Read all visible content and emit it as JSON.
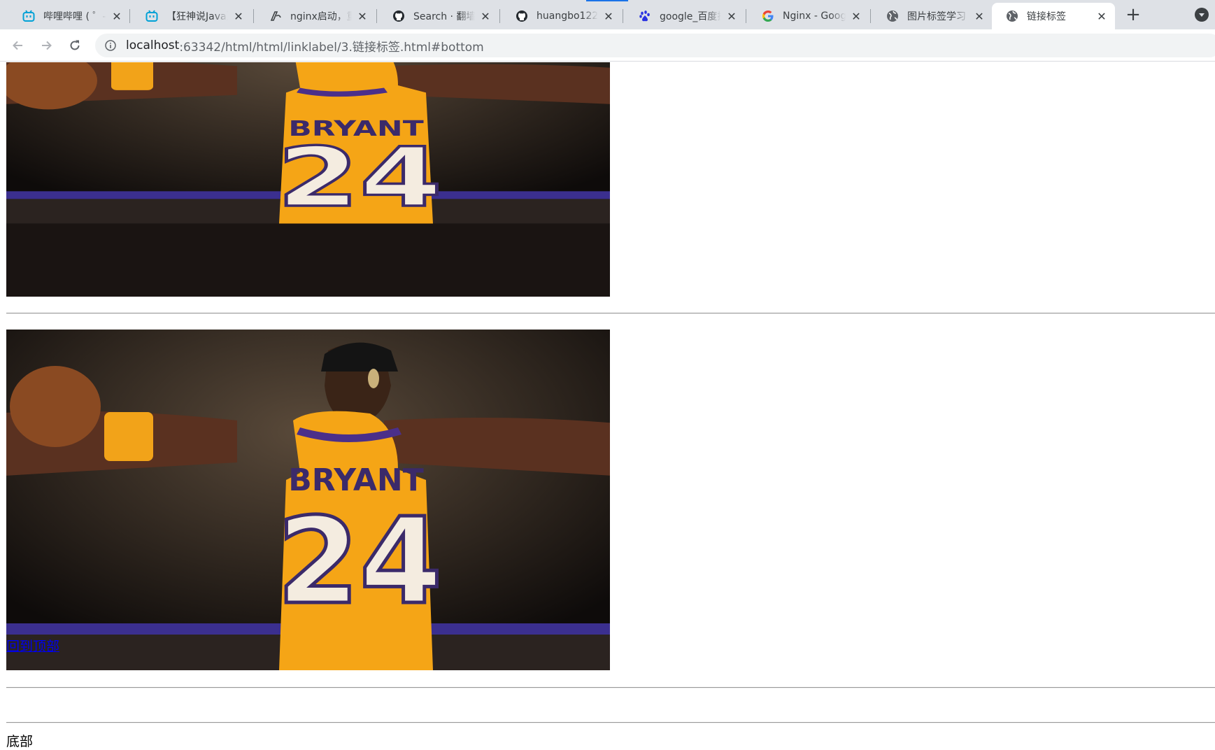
{
  "browser": {
    "tabs": [
      {
        "title": "哔哩哔哩 ( ゜- ゜)つロ 干杯~",
        "favicon": "bilibili-icon",
        "active": false
      },
      {
        "title": "【狂神说Java】",
        "favicon": "bilibili-icon",
        "active": false
      },
      {
        "title": "nginx启动，重启",
        "favicon": "csdn-icon",
        "active": false
      },
      {
        "title": "Search · 翻墙",
        "favicon": "github-icon",
        "active": false
      },
      {
        "title": "huangbo122",
        "favicon": "github-icon",
        "active": false
      },
      {
        "title": "google_百度搜索",
        "favicon": "baidu-icon",
        "active": false
      },
      {
        "title": "Nginx - Google",
        "favicon": "google-icon",
        "active": false
      },
      {
        "title": "图片标签学习",
        "favicon": "globe-icon",
        "active": false
      },
      {
        "title": "链接标签",
        "favicon": "globe-icon",
        "active": true
      }
    ],
    "close_glyph": "✕",
    "new_tab_glyph": "+",
    "url": {
      "host": "localhost",
      "path": ":63342/html/html/linklabel/3.链接标签.html#bottom"
    }
  },
  "page": {
    "image_top_alt": "BRYANT 24",
    "image_bottom_alt": "BRYANT 24",
    "jersey_name": "BRYANT",
    "jersey_number": "24",
    "back_to_top_link": "回到顶部",
    "bottom_text": "底部"
  }
}
